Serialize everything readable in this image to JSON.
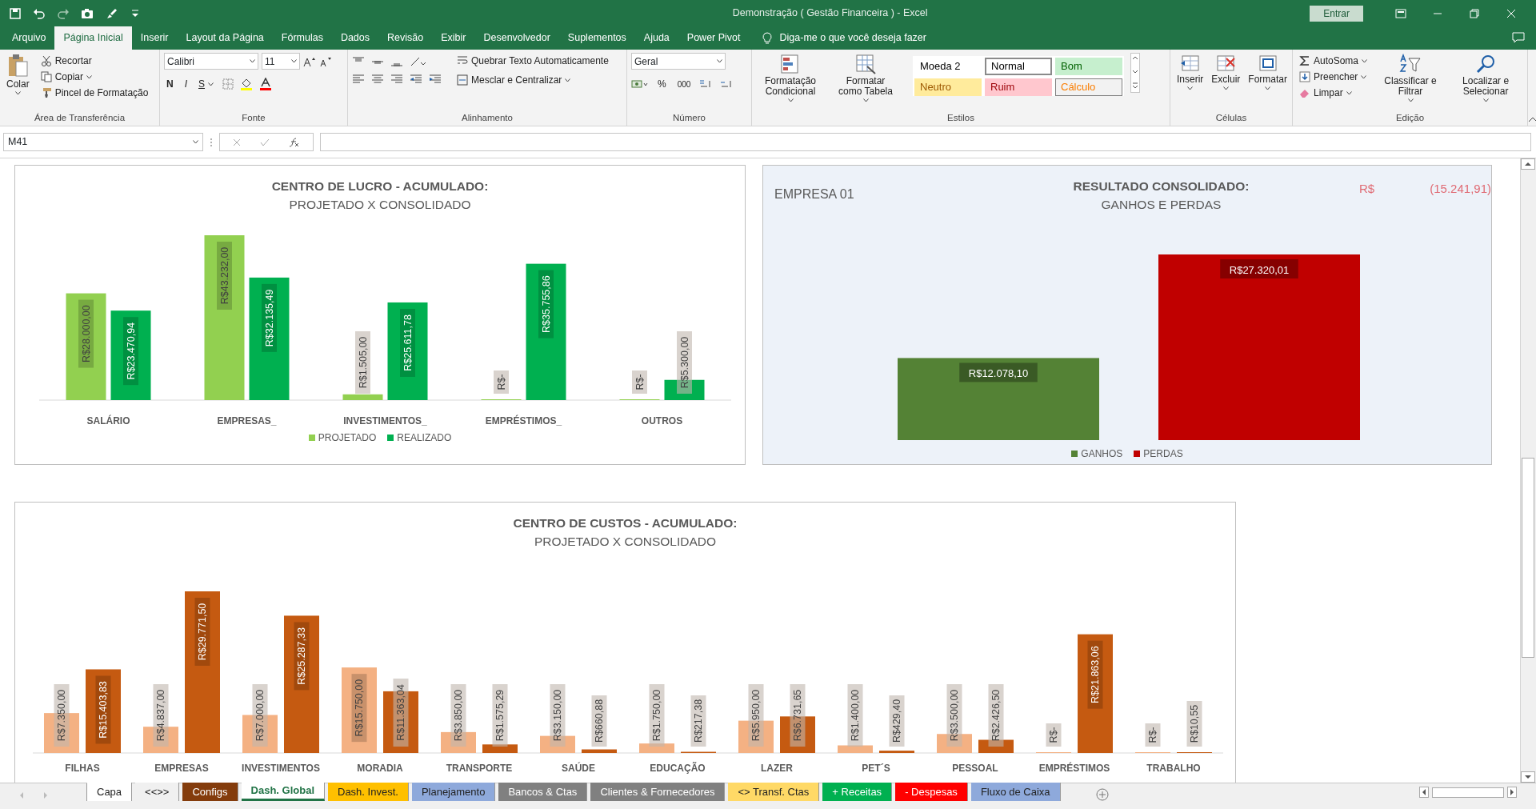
{
  "title_bar": {
    "title": "Demonstração ( Gestão Financeira ) - Excel",
    "sign_in": "Entrar"
  },
  "ribbon_tabs": [
    {
      "label": "Arquivo",
      "selected": false
    },
    {
      "label": "Página Inicial",
      "selected": true
    },
    {
      "label": "Inserir",
      "selected": false
    },
    {
      "label": "Layout da Página",
      "selected": false
    },
    {
      "label": "Fórmulas",
      "selected": false
    },
    {
      "label": "Dados",
      "selected": false
    },
    {
      "label": "Revisão",
      "selected": false
    },
    {
      "label": "Exibir",
      "selected": false
    },
    {
      "label": "Desenvolvedor",
      "selected": false
    },
    {
      "label": "Suplementos",
      "selected": false
    },
    {
      "label": "Ajuda",
      "selected": false
    },
    {
      "label": "Power Pivot",
      "selected": false
    }
  ],
  "tell_me": {
    "placeholder": "Diga-me o que você deseja fazer"
  },
  "ribbon": {
    "clipboard": {
      "label": "Área de Transferência",
      "paste": "Colar",
      "cut": "Recortar",
      "copy": "Copiar",
      "format_painter": "Pincel de Formatação"
    },
    "font": {
      "label": "Fonte",
      "font_name": "Calibri",
      "font_size": "11",
      "bold": "N",
      "italic": "I",
      "underline": "S"
    },
    "alignment": {
      "label": "Alinhamento",
      "wrap_text": "Quebrar Texto Automaticamente",
      "merge_center": "Mesclar e Centralizar"
    },
    "number": {
      "label": "Número",
      "format": "Geral",
      "percent": "%",
      "thousands": "000"
    },
    "styles": {
      "label": "Estilos",
      "conditional": "Formatação Condicional",
      "format_table": "Formatar como Tabela",
      "cell_styles": [
        {
          "label": "Moeda 2",
          "color": "#ffffff",
          "kind": "plain",
          "selected": false
        },
        {
          "label": "Normal",
          "color": "#ffffff",
          "kind": "plain",
          "selected": true
        },
        {
          "label": "Bom",
          "color": "#c6efce",
          "kind": "good",
          "selected": false
        },
        {
          "label": "Neutro",
          "color": "#ffeb9c",
          "kind": "neutral",
          "selected": false
        },
        {
          "label": "Ruim",
          "color": "#ffc7ce",
          "kind": "bad",
          "selected": false
        },
        {
          "label": "Cálculo",
          "color": "#f2f2f2",
          "kind": "calculation",
          "selected": false
        }
      ]
    },
    "cells": {
      "label": "Células",
      "insert": "Inserir",
      "delete": "Excluir",
      "format": "Formatar"
    },
    "editing": {
      "label": "Edição",
      "autosum": "AutoSoma",
      "fill": "Preencher",
      "clear": "Limpar",
      "sort_filter": "Classificar e Filtrar",
      "find_select": "Localizar e Selecionar"
    }
  },
  "formula_bar": {
    "name_box": "M41"
  },
  "profit_chart": {
    "subtitle": "PROJETADO X CONSOLIDADO",
    "chart_data": {
      "type": "bar",
      "title": "CENTRO DE LUCRO - ACUMULADO:",
      "categories": [
        "SALÁRIO",
        "EMPRESAS_",
        "INVESTIMENTOS_",
        "EMPRÉSTIMOS_",
        "OUTROS"
      ],
      "data_labels": true,
      "legend": true,
      "series": [
        {
          "name": "PROJETADO",
          "color": "#92d050",
          "values": [
            28000,
            43232,
            1505,
            0,
            0
          ],
          "value_labels": [
            "R$28.000,00",
            "R$43.232,00",
            "R$1.505,00",
            "R$-",
            "R$-"
          ]
        },
        {
          "name": "REALIZADO",
          "color": "#00b050",
          "values": [
            23470.94,
            32135.49,
            25611.78,
            35755.86,
            5300
          ],
          "value_labels": [
            "R$23.470,94",
            "R$32.135,49",
            "R$25.611,78",
            "R$35.755,86",
            "R$5.300,00"
          ]
        }
      ]
    }
  },
  "result_chart": {
    "company": "EMPRESA 01",
    "subtitle": "GANHOS E PERDAS",
    "currency": "R$",
    "result": "(15.241,91)",
    "chart_data": {
      "type": "bar",
      "title": "RESULTADO CONSOLIDADO:",
      "data_labels": true,
      "legend": true,
      "series": [
        {
          "name": "GANHOS",
          "color": "#548235",
          "values": [
            12078.1
          ],
          "value_labels": [
            "R$12.078,10"
          ]
        },
        {
          "name": "PERDAS",
          "color": "#c00000",
          "values": [
            27320.01
          ],
          "value_labels": [
            "R$27.320,01"
          ]
        }
      ]
    }
  },
  "cost_chart": {
    "subtitle": "PROJETADO X CONSOLIDADO",
    "chart_data": {
      "type": "bar",
      "title": "CENTRO DE CUSTOS - ACUMULADO:",
      "categories": [
        "FILHAS",
        "EMPRESAS",
        "INVESTIMENTOS",
        "MORADIA",
        "TRANSPORTE",
        "SAÚDE",
        "EDUCAÇÃO",
        "LAZER",
        "PET´S",
        "PESSOAL",
        "EMPRÉSTIMOS",
        "TRABALHO"
      ],
      "data_labels": true,
      "series": [
        {
          "color": "#f4b183",
          "values": [
            7350,
            4837,
            7000,
            15750,
            3850,
            3150,
            1750,
            5950,
            1400,
            3500,
            0,
            0
          ],
          "value_labels": [
            "R$7.350,00",
            "R$4.837,00",
            "R$7.000,00",
            "R$15.750,00",
            "R$3.850,00",
            "R$3.150,00",
            "R$1.750,00",
            "R$5.950,00",
            "R$1.400,00",
            "R$3.500,00",
            "R$-",
            "R$-"
          ]
        },
        {
          "color": "#c55a11",
          "values": [
            15403.83,
            29771.5,
            25287.33,
            11363.04,
            1575.29,
            660.88,
            217.38,
            6731.65,
            429.4,
            2426.5,
            21863.06,
            10.55
          ],
          "value_labels": [
            "R$15.403,83",
            "R$29.771,50",
            "R$25.287,33",
            "R$11.363,04",
            "R$1.575,29",
            "R$660,88",
            "R$217,38",
            "R$6.731,65",
            "R$429,40",
            "R$2.426,50",
            "R$21.863,06",
            "R$10,55"
          ]
        }
      ]
    }
  },
  "sheet_tabs": [
    {
      "label": "Capa",
      "color": "#ffffff",
      "selected": false
    },
    {
      "label": "<<>>",
      "selected": false
    },
    {
      "label": "Configs",
      "color": "#843c0c",
      "selected": false
    },
    {
      "label": "Dash. Global",
      "selected": true
    },
    {
      "label": "Dash. Invest.",
      "color": "#ffc000",
      "selected": false
    },
    {
      "label": "Planejamento",
      "color": "#8ea9db",
      "selected": false
    },
    {
      "label": "Bancos & Ctas",
      "color": "#808080",
      "selected": false
    },
    {
      "label": "Clientes & Fornecedores",
      "color": "#808080",
      "selected": false
    },
    {
      "label": "<> Transf. Ctas",
      "color": "#ffd966",
      "selected": false
    },
    {
      "label": "+ Receitas",
      "color": "#00b050",
      "selected": false
    },
    {
      "label": "- Despesas",
      "color": "#ff0000",
      "selected": false
    },
    {
      "label": "Fluxo de Caixa",
      "color": "#8ea9db",
      "selected": false
    }
  ]
}
